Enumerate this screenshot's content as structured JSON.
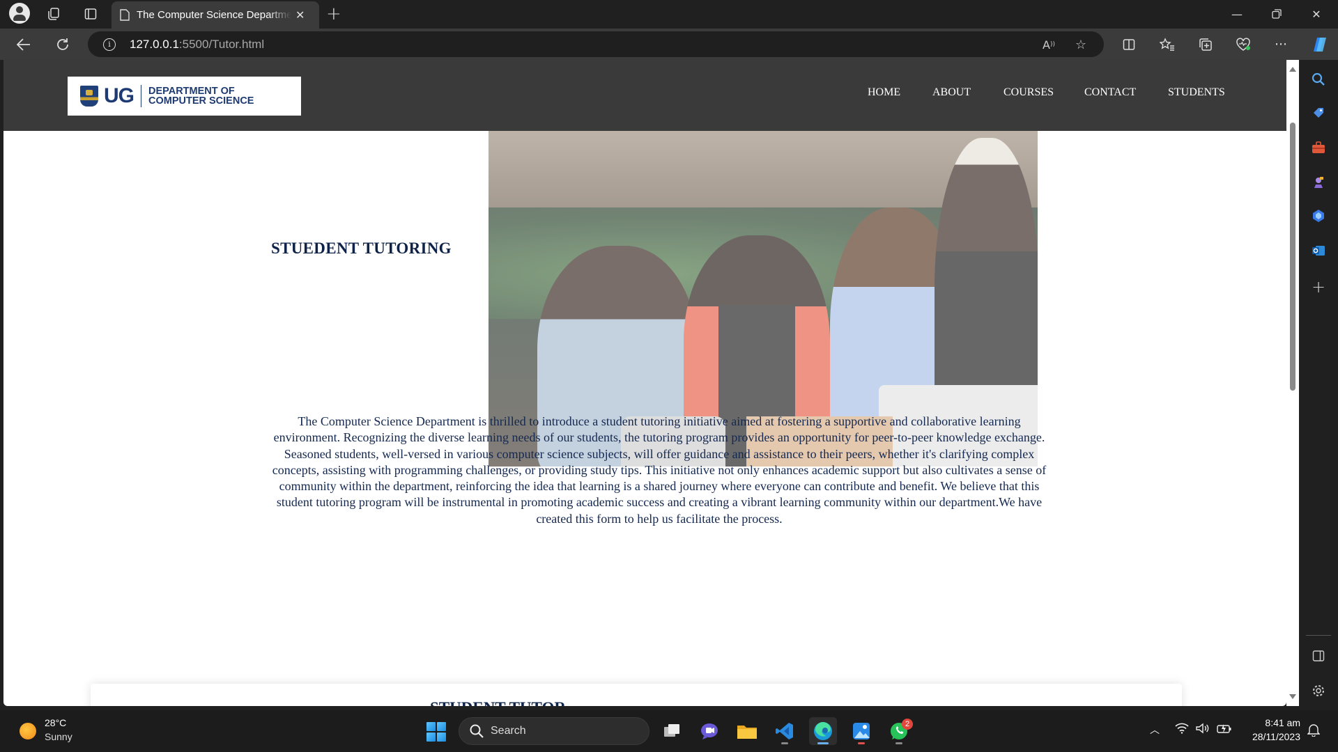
{
  "browser": {
    "tab_title": "The Computer Science Department",
    "url_host": "127.0.0.1",
    "url_path": ":5500/Tutor.html"
  },
  "site": {
    "logo_ug": "UG",
    "logo_dept_line1": "DEPARTMENT OF",
    "logo_dept_line2": "COMPUTER SCIENCE",
    "nav": [
      "HOME",
      "ABOUT",
      "COURSES",
      "CONTACT",
      "STUDENTS"
    ],
    "heading": "STUEDENT TUTORING",
    "body": "The Computer Science Department is thrilled to introduce a student tutoring initiative aimed at fostering a supportive and collaborative learning environment. Recognizing the diverse learning needs of our students, the tutoring program provides an opportunity for peer-to-peer knowledge exchange. Seasoned students, well-versed in various computer science subjects, will offer guidance and assistance to their peers, whether it's clarifying complex concepts, assisting with programming challenges, or providing study tips. This initiative not only enhances academic support but also cultivates a sense of community within the department, reinforcing the idea that learning is a shared journey where everyone can contribute and benefit. We believe that this student tutoring program will be instrumental in promoting academic success and creating a vibrant learning community within our department.We have created this form to help us facilitate the process.",
    "card_title": "STUDENT TUTOR"
  },
  "taskbar": {
    "weather_temp": "28°C",
    "weather_desc": "Sunny",
    "search_label": "Search",
    "whatsapp_badge": "2",
    "time": "8:41 am",
    "date": "28/11/2023"
  },
  "colors": {
    "site_header": "#3a3a3a",
    "heading_navy": "#0f2348",
    "browser_dark": "#202020"
  }
}
